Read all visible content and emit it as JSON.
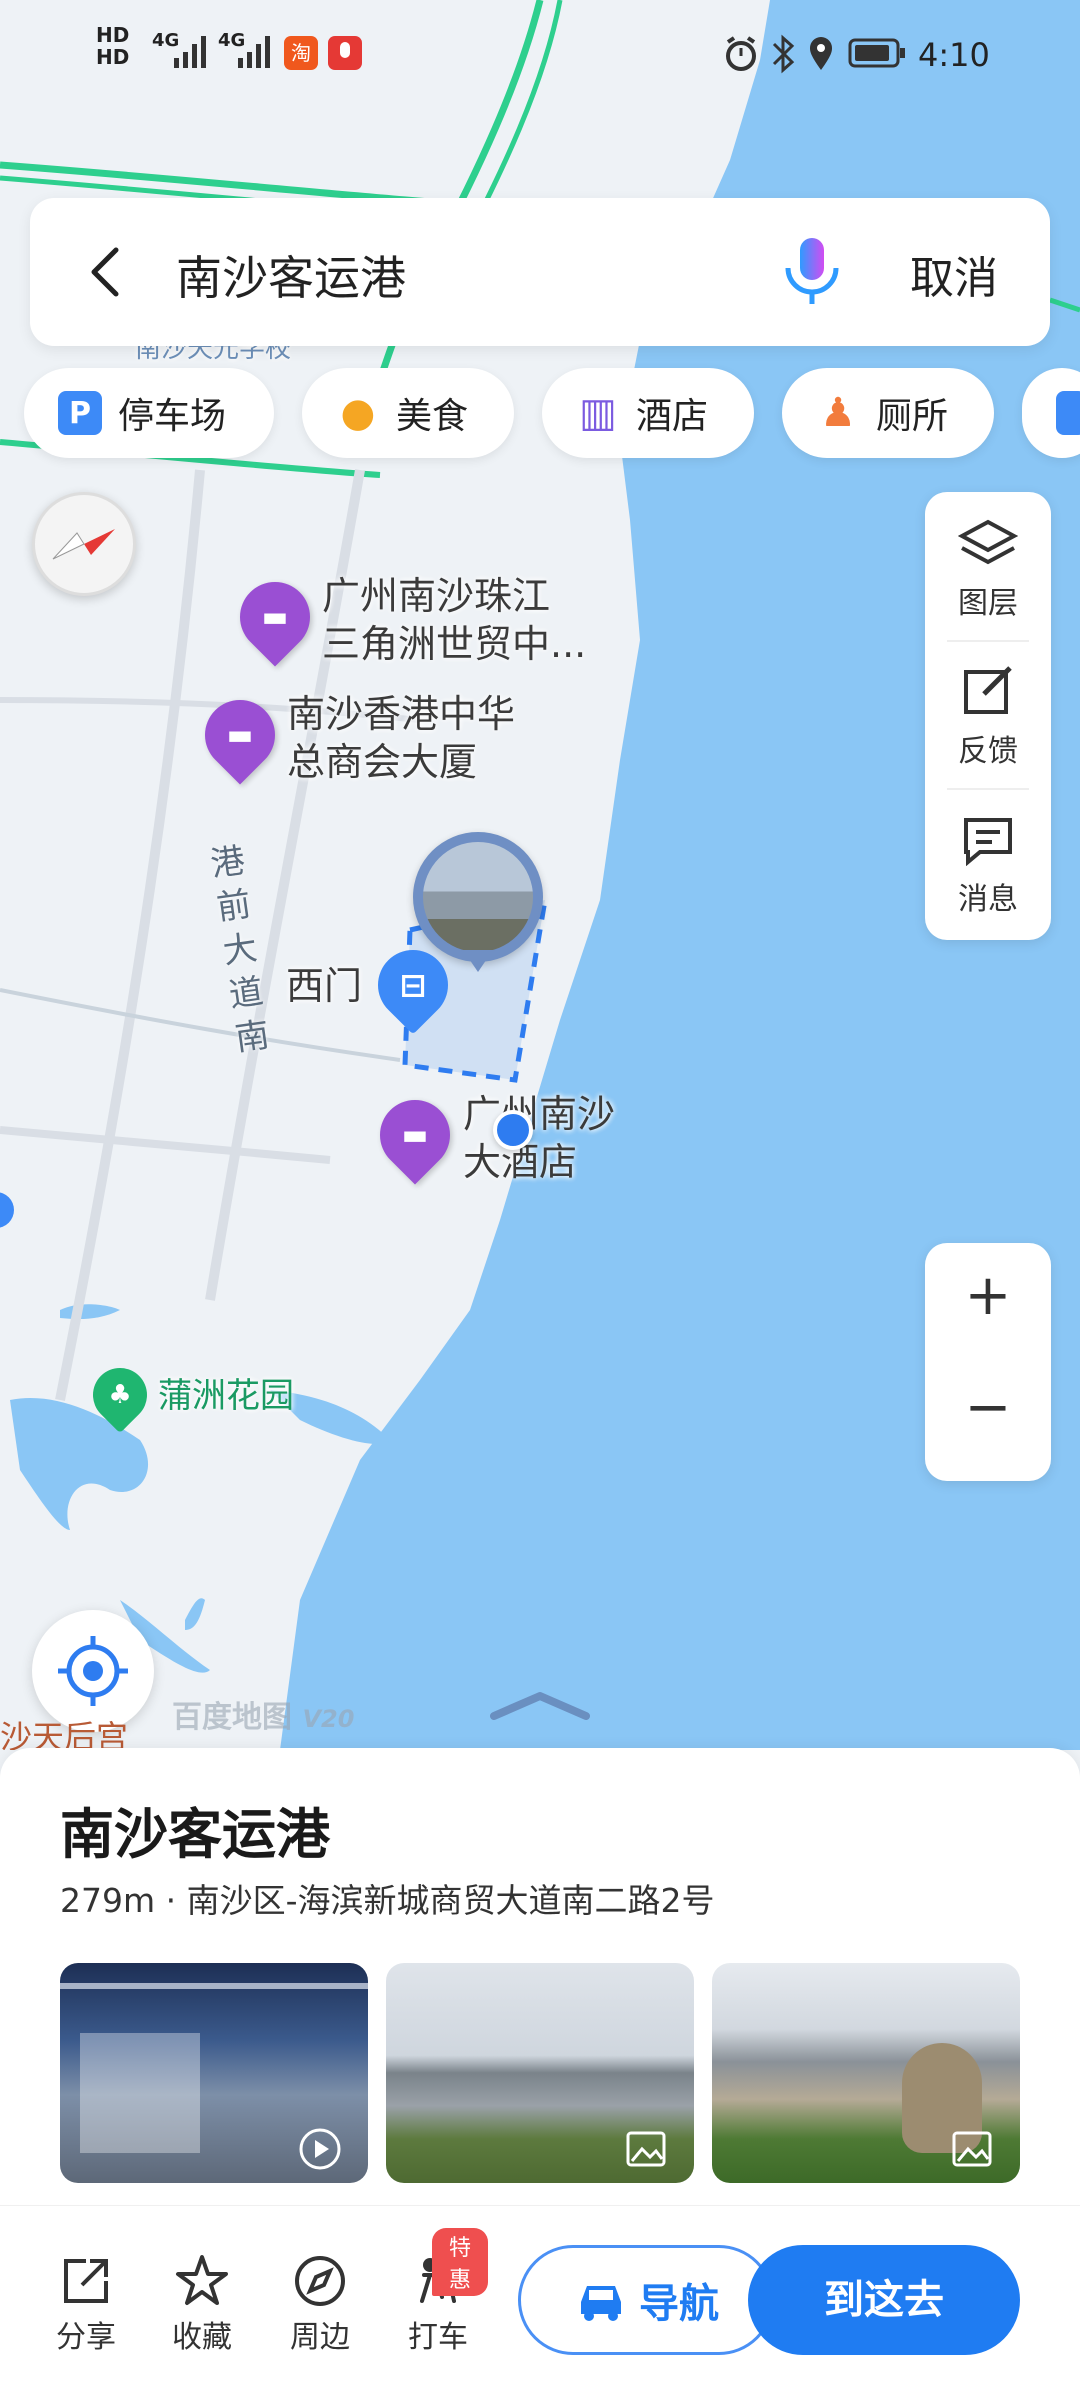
{
  "status": {
    "time": "4:10",
    "hd1": "HD",
    "hd2": "HD",
    "net1": "4G",
    "net2": "4G",
    "app_badge": "淘"
  },
  "search": {
    "query": "南沙客运港",
    "cancel_label": "取消"
  },
  "chips": [
    {
      "label": "停车场",
      "icon": "parking-icon",
      "glyph": "P",
      "color": "#3d8af7"
    },
    {
      "label": "美食",
      "icon": "food-icon",
      "glyph": "●",
      "color": "#f5a623"
    },
    {
      "label": "酒店",
      "icon": "hotel-icon",
      "glyph": "▥",
      "color": "#7b5be0"
    },
    {
      "label": "厕所",
      "icon": "toilet-icon",
      "glyph": "♟",
      "color": "#f27c3d"
    }
  ],
  "tools": {
    "layers": "图层",
    "feedback": "反馈",
    "messages": "消息"
  },
  "zoom": {
    "in": "+",
    "out": "−"
  },
  "map": {
    "hidden_school": "南沙天元学校",
    "poi1_line1": "广州南沙珠江",
    "poi1_line2": "三角洲世贸中...",
    "poi2_line1": "南沙香港中华",
    "poi2_line2": "总商会大厦",
    "road": "港前大道南",
    "west_gate": "西门",
    "hotel_line1": "广州南沙",
    "hotel_line2": "大酒店",
    "park": "蒲洲花园",
    "watermark": "百度地图",
    "watermark_version": "V20",
    "temple": "沙天后宫"
  },
  "place": {
    "name": "南沙客运港",
    "distance": "279m",
    "address": "南沙区-海滨新城商贸大道南二路2号"
  },
  "actions": {
    "share": "分享",
    "favorite": "收藏",
    "nearby": "周边",
    "taxi": "打车",
    "taxi_badge": "特惠",
    "navigate": "导航",
    "go_here": "到这去"
  },
  "colors": {
    "water": "#8ac6f5",
    "land": "#eef2f6",
    "accent": "#1f7cf2",
    "poi_purple": "#9a4fd3"
  }
}
